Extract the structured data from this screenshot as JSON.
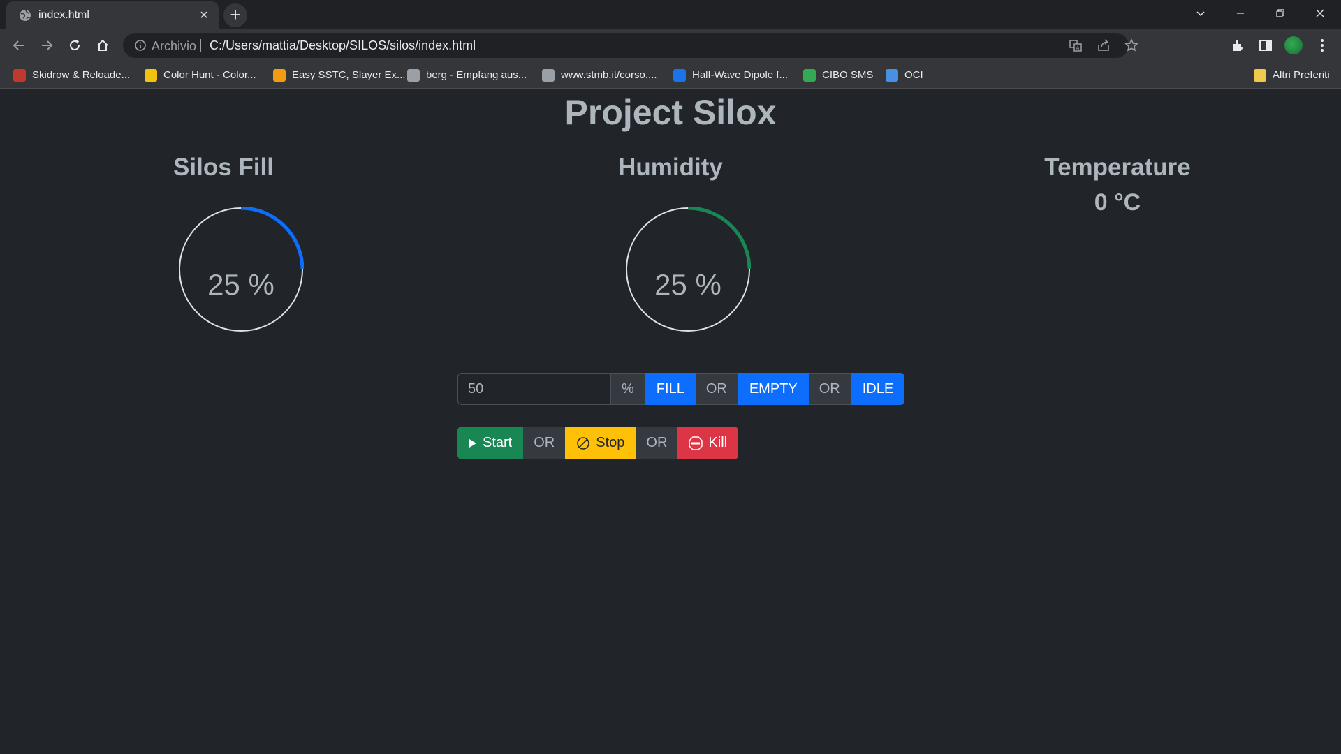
{
  "browser": {
    "tab_title": "index.html",
    "tab_close": "×",
    "new_tab": "+",
    "omnibox_scheme": "Archivio",
    "omnibox_url": "C:/Users/mattia/Desktop/SILOS/silos/index.html"
  },
  "bookmarks": {
    "items": [
      {
        "label": "Skidrow & Reloade...",
        "color": "#c0392b"
      },
      {
        "label": "Color Hunt - Color...",
        "color": "#f1c40f"
      },
      {
        "label": "Easy SSTC, Slayer Ex...",
        "color": "#f39c12"
      },
      {
        "label": "berg - Empfang aus...",
        "color": "#9aa0a6"
      },
      {
        "label": "www.stmb.it/corso....",
        "color": "#9aa0a6"
      },
      {
        "label": "Half-Wave Dipole f...",
        "color": "#1a73e8"
      },
      {
        "label": "CIBO SMS",
        "color": "#34a853"
      },
      {
        "label": "OCI",
        "color": "#4a90e2"
      }
    ],
    "other": "Altri Preferiti"
  },
  "page": {
    "title": "Project Silox",
    "silos_fill": {
      "title": "Silos Fill",
      "value": 25,
      "label": "25 %",
      "color": "#0d6efd"
    },
    "humidity": {
      "title": "Humidity",
      "value": 25,
      "label": "25 %",
      "color": "#198754"
    },
    "temperature": {
      "title": "Temperature",
      "value": "0 °C"
    },
    "controls": {
      "percent_value": "50",
      "percent_unit": "%",
      "fill": "FILL",
      "or1": "OR",
      "empty": "EMPTY",
      "or2": "OR",
      "idle": "IDLE"
    },
    "actions": {
      "start": "Start",
      "or1": "OR",
      "stop": "Stop",
      "or2": "OR",
      "kill": "Kill"
    }
  }
}
